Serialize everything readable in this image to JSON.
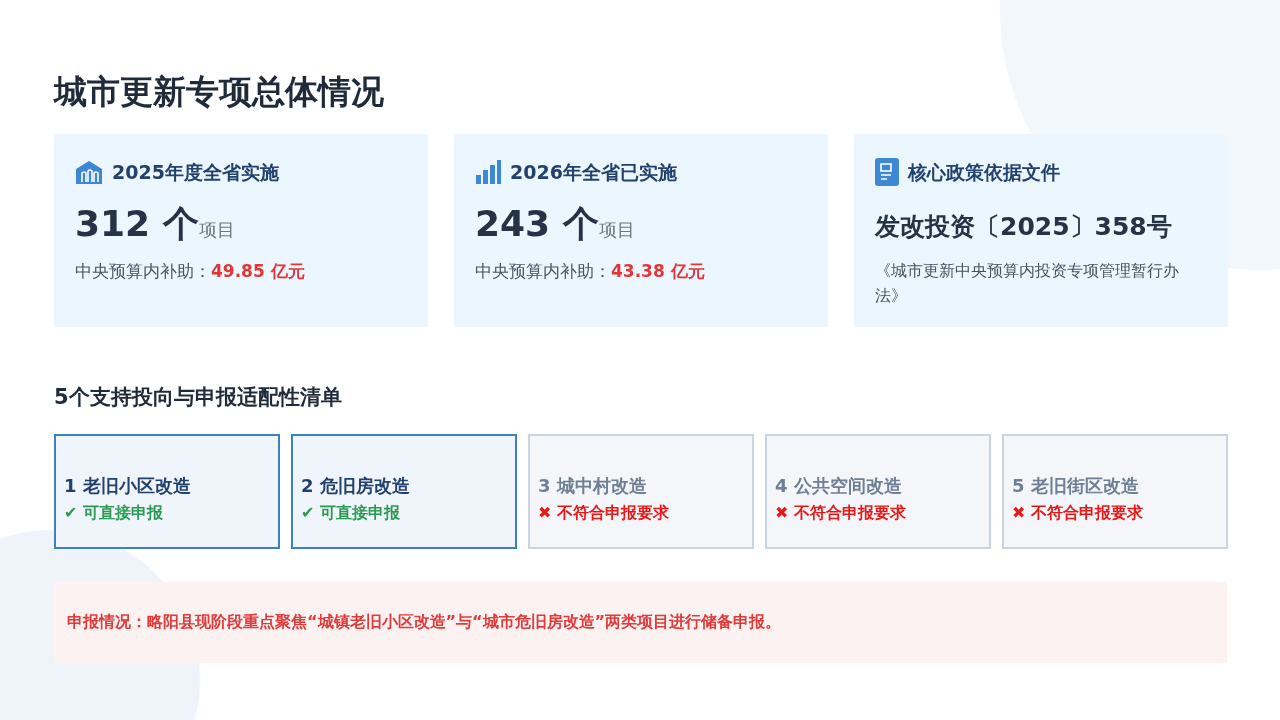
{
  "title": "城市更新专项总体情况",
  "cards": [
    {
      "kind": "stat",
      "heading": "2025年度全省实施",
      "number": "312 个",
      "unit": "项目",
      "subsidy_label": "中央预算内补助：",
      "subsidy_value": "49.85 亿元"
    },
    {
      "kind": "stat",
      "heading": "2026年全省已实施",
      "number": "243 个",
      "unit": "项目",
      "subsidy_label": "中央预算内补助：",
      "subsidy_value": "43.38 亿元"
    },
    {
      "kind": "policy",
      "heading": "核心政策依据文件",
      "number": "发改投资〔2025〕358号",
      "note": "《城市更新中央预算内投资专项管理暂行办法》"
    }
  ],
  "section_title": "5个支持投向与申报适配性清单",
  "directions": [
    {
      "label": "1 老旧小区改造",
      "status": "✔ 可直接申报",
      "eligible": true
    },
    {
      "label": "2 危旧房改造",
      "status": "✔ 可直接申报",
      "eligible": true
    },
    {
      "label": "3 城中村改造",
      "status": "✖ 不符合申报要求",
      "eligible": false
    },
    {
      "label": "4 公共空间改造",
      "status": "✖ 不符合申报要求",
      "eligible": false
    },
    {
      "label": "5 老旧街区改造",
      "status": "✖ 不符合申报要求",
      "eligible": false
    }
  ],
  "notice": "申报情况：略阳县现阶段重点聚焦“城镇老旧小区改造”与“城市危旧房改造”两类项目进行储备申报。"
}
